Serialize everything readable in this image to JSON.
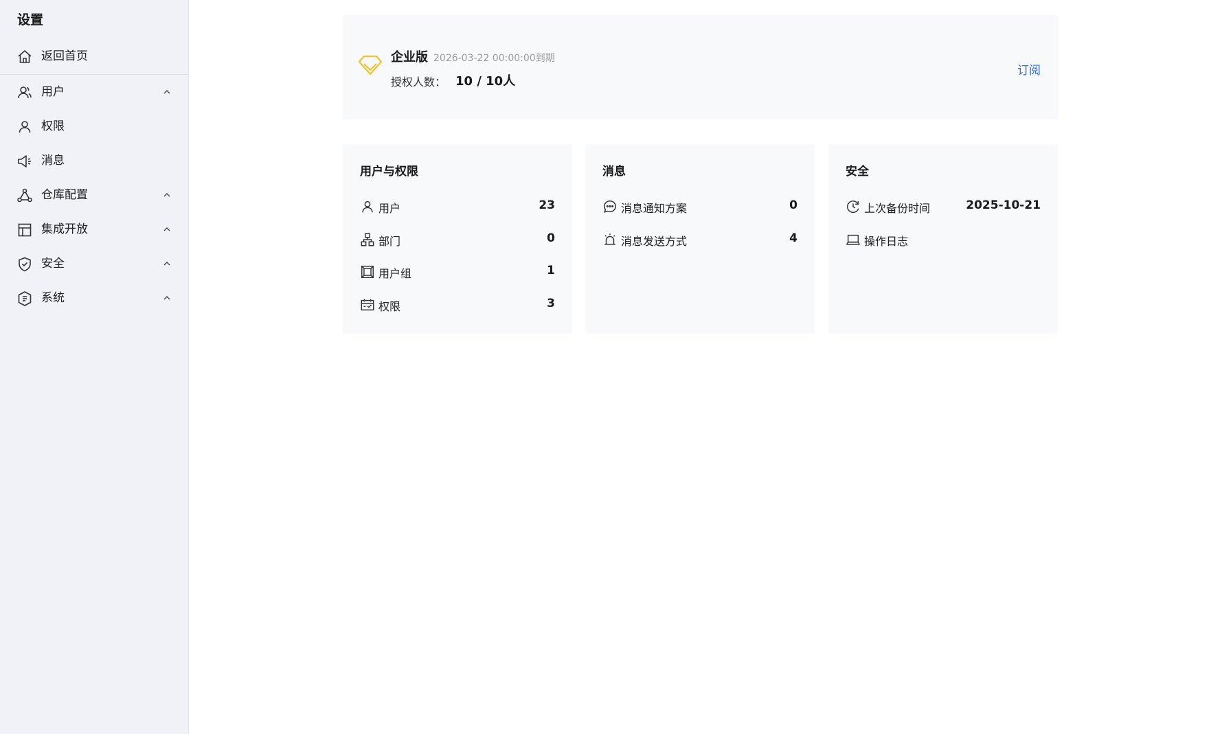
{
  "sidebar": {
    "title": "设置",
    "items": [
      {
        "label": "返回首页",
        "icon": "home-icon"
      },
      {
        "label": "用户",
        "icon": "users-icon",
        "expandable": true
      },
      {
        "label": "权限",
        "icon": "user-icon"
      },
      {
        "label": "消息",
        "icon": "megaphone-icon"
      },
      {
        "label": "仓库配置",
        "icon": "nodes-icon",
        "expandable": true
      },
      {
        "label": "集成开放",
        "icon": "layout-icon",
        "expandable": true
      },
      {
        "label": "安全",
        "icon": "shield-check-icon",
        "expandable": true
      },
      {
        "label": "系统",
        "icon": "shield-cert-icon",
        "expandable": true
      }
    ]
  },
  "license": {
    "edition": "企业版",
    "expiry": "2026-03-22 00:00:00到期",
    "seats_label": "授权人数：",
    "seats_value": "10 / 10人",
    "subscribe_label": "订阅",
    "icon": "diamond-icon",
    "accent_color": "#f0c22e"
  },
  "cards": [
    {
      "title": "用户与权限",
      "rows": [
        {
          "label": "用户",
          "value": "23",
          "icon": "user-icon"
        },
        {
          "label": "部门",
          "value": "0",
          "icon": "org-chart-icon"
        },
        {
          "label": "用户组",
          "value": "1",
          "icon": "group-icon"
        },
        {
          "label": "权限",
          "value": "3",
          "icon": "calendar-check-icon"
        }
      ]
    },
    {
      "title": "消息",
      "rows": [
        {
          "label": "消息通知方案",
          "value": "0",
          "icon": "chat-bubble-icon"
        },
        {
          "label": "消息发送方式",
          "value": "4",
          "icon": "alarm-icon"
        }
      ]
    },
    {
      "title": "安全",
      "rows": [
        {
          "label": "上次备份时间",
          "value": "2025-10-21",
          "icon": "clock-icon"
        },
        {
          "label": "操作日志",
          "value": "",
          "icon": "laptop-icon"
        }
      ]
    }
  ],
  "colors": {
    "sidebar_bg": "#f0f2f8",
    "card_bg": "#f8f9fb",
    "link": "#2f6fd6"
  }
}
